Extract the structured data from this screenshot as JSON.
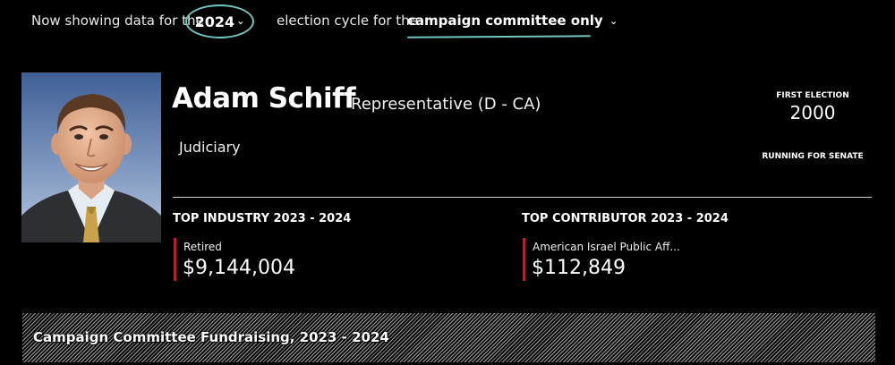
{
  "selector": {
    "prefix": "Now showing data for the",
    "year": "2024",
    "middle": "election cycle for the",
    "committee_filter": "campaign committee only",
    "accent_color": "#6fc7c0"
  },
  "profile": {
    "name": "Adam Schiff",
    "role": "Representative (D - CA)",
    "committee": "Judiciary",
    "first_election_label": "FIRST ELECTION",
    "first_election_year": "2000",
    "status": "RUNNING FOR SENATE",
    "photo_alt": "portrait-photo"
  },
  "stats": {
    "industry": {
      "title": "TOP INDUSTRY 2023 - 2024",
      "label": "Retired",
      "value": "$9,144,004"
    },
    "contributor": {
      "title": "TOP CONTRIBUTOR 2023 - 2024",
      "label": "American Israel Public Aff...",
      "value": "$112,849"
    },
    "accent_color": "#b3202e"
  },
  "banner": {
    "title": "Campaign Committee Fundraising, 2023 - 2024"
  },
  "icons": {
    "year_dropdown": "chevron-down-icon",
    "committee_dropdown": "chevron-down-icon"
  }
}
